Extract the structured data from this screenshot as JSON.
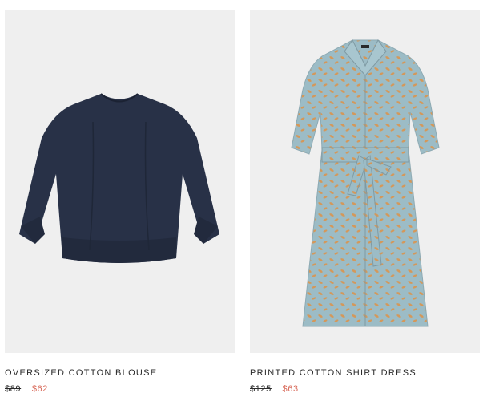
{
  "products": [
    {
      "name": "OVERSIZED COTTON BLOUSE",
      "original_price": "$89",
      "sale_price": "$62",
      "image": "navy-blouse-image",
      "colors": {
        "garment": "#283147",
        "background": "#efefef"
      }
    },
    {
      "name": "PRINTED COTTON SHIRT DRESS",
      "original_price": "$125",
      "sale_price": "$63",
      "image": "printed-shirt-dress-image",
      "colors": {
        "garment": "#9cbcc6",
        "print": "#d4985a",
        "background": "#efefef"
      }
    }
  ],
  "colors": {
    "sale": "#d86a5a",
    "text": "#2a2a2a"
  }
}
